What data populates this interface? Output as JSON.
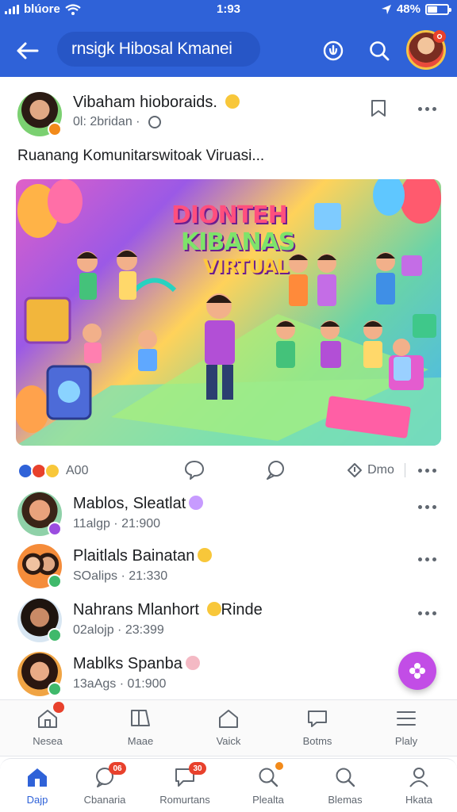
{
  "status_bar": {
    "carrier": "blúore",
    "time": "1:93",
    "battery": "48%",
    "battery_level": 0.48
  },
  "app_bar": {
    "title": "rnsigk Hibosal Kmanei"
  },
  "post": {
    "author": "Vibaham hioboraids.",
    "meta": "0l: 2bridan ·",
    "text": "Ruanang Komunitarswitoak Viruasi...",
    "banner": {
      "line1": "DIONTEH",
      "line2": "KIBANAS",
      "line3": "VIRTUAL"
    },
    "reaction_count": "A00",
    "share_label": "Dmo"
  },
  "comments": [
    {
      "name": "Mablos, Sleatlat",
      "meta": "11algp  ·  21:900",
      "emoji": true
    },
    {
      "name": "Plaitlals Bainatan",
      "meta": "SOalips  ·  21:330",
      "emoji": true
    },
    {
      "name": "Nahrans Mlanhort",
      "name_suffix": "Rinde",
      "meta": "02alojp  ·  23:399",
      "emoji": true
    },
    {
      "name": "Mablks Spanba",
      "meta": "13aAgs  ·  01:900",
      "emoji": true
    }
  ],
  "toolbar": {
    "items": [
      {
        "label": "Nesea",
        "icon": "home-outline-icon"
      },
      {
        "label": "Maae",
        "icon": "book-icon"
      },
      {
        "label": "Vaick",
        "icon": "house-icon"
      },
      {
        "label": "Botms",
        "icon": "chat-icon"
      },
      {
        "label": "Plaly",
        "icon": "list-icon"
      }
    ]
  },
  "bottom_nav": {
    "items": [
      {
        "label": "Dajp",
        "icon": "home-icon",
        "active": true
      },
      {
        "label": "Cbanaria",
        "icon": "chat-bubble-icon",
        "badge": "06"
      },
      {
        "label": "Romurtans",
        "icon": "message-icon",
        "badge": "30"
      },
      {
        "label": "Plealta",
        "icon": "search-person-icon"
      },
      {
        "label": "Blemas",
        "icon": "search-icon"
      },
      {
        "label": "Hkata",
        "icon": "profile-icon"
      }
    ]
  },
  "colors": {
    "brand": "#2f62d8",
    "fab": "#c24de6",
    "badge": "#e8412c"
  }
}
